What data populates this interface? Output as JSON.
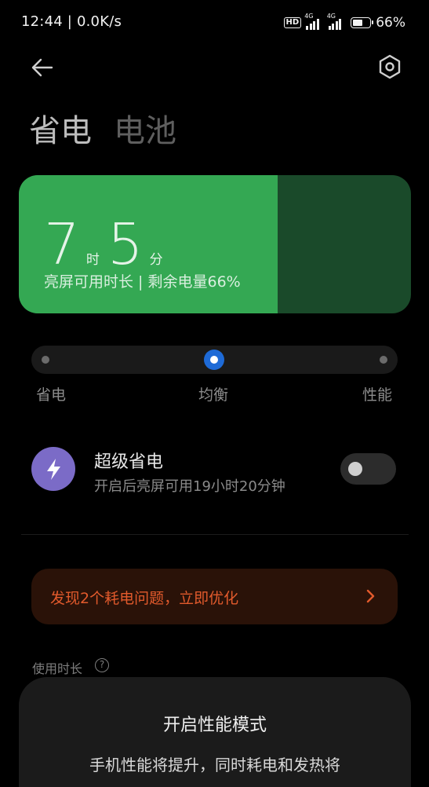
{
  "status_bar": {
    "time": "12:44",
    "separator": "|",
    "speed": "0.0K/s",
    "hd_badge": "HD",
    "sim1_network": "4G",
    "sim2_network": "4G",
    "battery_percent": "66%",
    "battery_level": 0.66
  },
  "header": {
    "tabs": [
      {
        "label": "省电",
        "active": true
      },
      {
        "label": "电池",
        "active": false
      }
    ]
  },
  "battery_card": {
    "hours": "7",
    "hours_unit": "时",
    "minutes": "5",
    "minutes_unit": "分",
    "subtitle": "亮屏可用时长 | 剩余电量66%",
    "level": 0.66,
    "colors": {
      "fill": "#34a853",
      "empty": "#1a4a2a"
    }
  },
  "mode_slider": {
    "modes": [
      "省电",
      "均衡",
      "性能"
    ],
    "selected": "均衡",
    "accent": "#1e6ad6"
  },
  "super_saver": {
    "title": "超级省电",
    "description": "开启后亮屏可用19小时20分钟",
    "enabled": false,
    "icon": "lightning-icon",
    "icon_color": "#7b6bc7"
  },
  "issue_banner": {
    "text": "发现2个耗电问题，立即优化",
    "color": "#e25a2c"
  },
  "usage": {
    "label": "使用时长",
    "help_symbol": "?"
  },
  "sheet": {
    "title": "开启性能模式",
    "description": "手机性能将提升，同时耗电和发热将"
  }
}
